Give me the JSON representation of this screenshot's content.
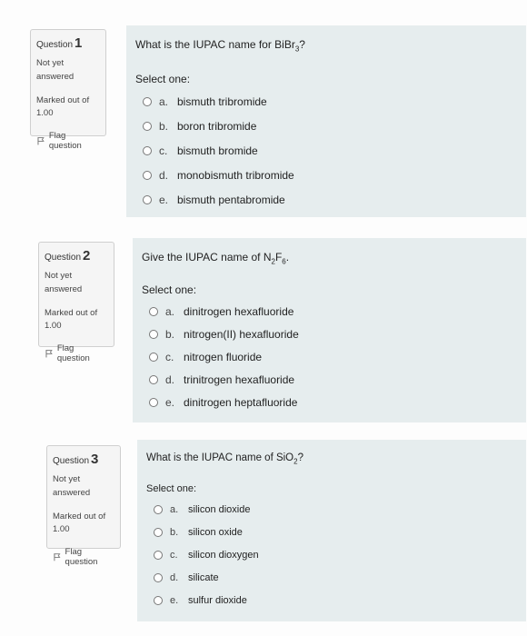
{
  "questions": [
    {
      "number_label": "Question",
      "number": "1",
      "state": "Not yet answered",
      "marks_label": "Marked out of",
      "marks_value": "1.00",
      "flag_label": "Flag question",
      "text_pre": "What is the IUPAC name for BiBr",
      "text_sub": "3",
      "text_post": "?",
      "prompt": "Select one:",
      "options": [
        {
          "letter": "a.",
          "text": "bismuth tribromide"
        },
        {
          "letter": "b.",
          "text": "boron tribromide"
        },
        {
          "letter": "c.",
          "text": "bismuth bromide"
        },
        {
          "letter": "d.",
          "text": "monobismuth tribromide"
        },
        {
          "letter": "e.",
          "text": "bismuth pentabromide"
        }
      ]
    },
    {
      "number_label": "Question",
      "number": "2",
      "state": "Not yet answered",
      "marks_label": "Marked out of",
      "marks_value": "1.00",
      "flag_label": "Flag question",
      "text_pre": "Give the IUPAC name of N",
      "text_sub": "2",
      "text_mid": "F",
      "text_sub2": "6",
      "text_post": ".",
      "prompt": "Select one:",
      "options": [
        {
          "letter": "a.",
          "text": "dinitrogen hexafluoride"
        },
        {
          "letter": "b.",
          "text": "nitrogen(II) hexafluoride"
        },
        {
          "letter": "c.",
          "text": "nitrogen fluoride"
        },
        {
          "letter": "d.",
          "text": "trinitrogen hexafluoride"
        },
        {
          "letter": "e.",
          "text": "dinitrogen heptafluoride"
        }
      ]
    },
    {
      "number_label": "Question",
      "number": "3",
      "state": "Not yet answered",
      "marks_label": "Marked out of",
      "marks_value": "1.00",
      "flag_label": "Flag question",
      "text_pre": "What is the IUPAC name of SiO",
      "text_sub": "2",
      "text_post": "?",
      "prompt": "Select one:",
      "options": [
        {
          "letter": "a.",
          "text": "silicon dioxide"
        },
        {
          "letter": "b.",
          "text": "silicon oxide"
        },
        {
          "letter": "c.",
          "text": "silicon dioxygen"
        },
        {
          "letter": "d.",
          "text": "silicate"
        },
        {
          "letter": "e.",
          "text": "sulfur dioxide"
        }
      ]
    }
  ]
}
